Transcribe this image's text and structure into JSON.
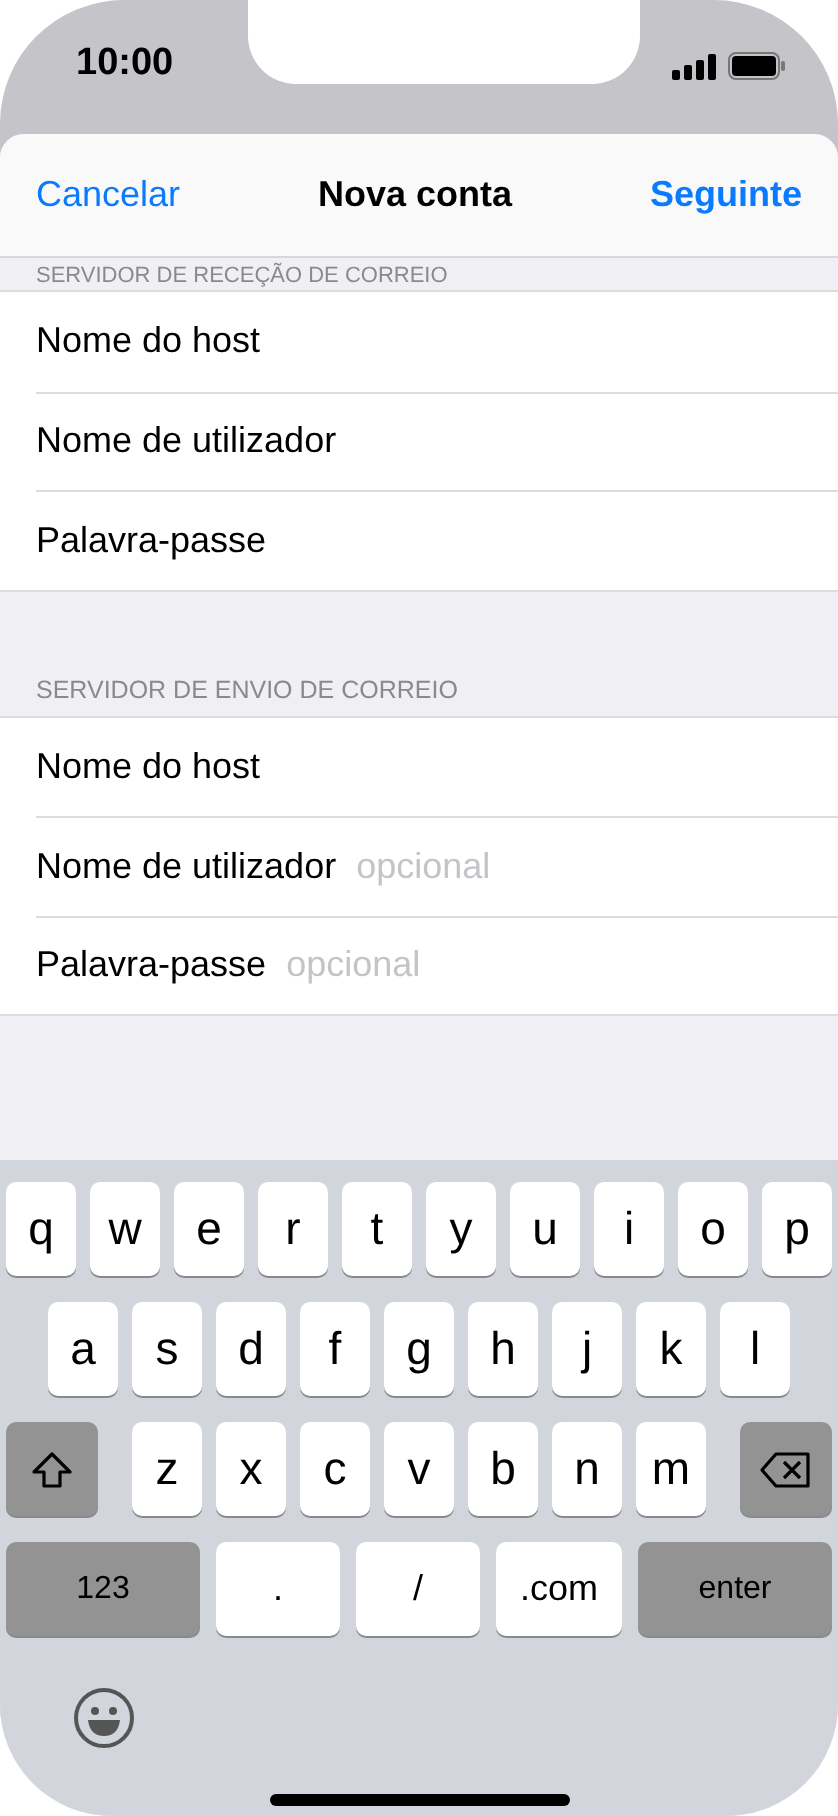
{
  "status_bar": {
    "time": "10:00"
  },
  "nav": {
    "left": "Cancelar",
    "title": "Nova conta",
    "right": "Seguinte"
  },
  "sections": [
    {
      "header": "SERVIDOR DE RECEÇÃO DE CORREIO",
      "header_clipped": true,
      "fields": [
        {
          "label": "Nome do host"
        },
        {
          "label": "Nome de utilizador"
        },
        {
          "label": "Palavra-passe"
        }
      ]
    },
    {
      "header": "SERVIDOR DE ENVIO DE CORREIO",
      "header_clipped": false,
      "fields": [
        {
          "label": "Nome do host"
        },
        {
          "label": "Nome de utilizador",
          "placeholder": "opcional"
        },
        {
          "label": "Palavra-passe",
          "placeholder": "opcional"
        }
      ]
    }
  ],
  "keyboard": {
    "rows": [
      {
        "keys": [
          {
            "kind": "letter",
            "label": "q"
          },
          {
            "kind": "letter",
            "label": "w"
          },
          {
            "kind": "letter",
            "label": "e"
          },
          {
            "kind": "letter",
            "label": "r"
          },
          {
            "kind": "letter",
            "label": "t"
          },
          {
            "kind": "letter",
            "label": "y"
          },
          {
            "kind": "letter",
            "label": "u"
          },
          {
            "kind": "letter",
            "label": "i"
          },
          {
            "kind": "letter",
            "label": "o"
          },
          {
            "kind": "letter",
            "label": "p"
          }
        ]
      },
      {
        "keys": [
          {
            "kind": "letter",
            "label": "a"
          },
          {
            "kind": "letter",
            "label": "s"
          },
          {
            "kind": "letter",
            "label": "d"
          },
          {
            "kind": "letter",
            "label": "f"
          },
          {
            "kind": "letter",
            "label": "g"
          },
          {
            "kind": "letter",
            "label": "h"
          },
          {
            "kind": "letter",
            "label": "j"
          },
          {
            "kind": "letter",
            "label": "k"
          },
          {
            "kind": "letter",
            "label": "l"
          }
        ]
      },
      {
        "keys": [
          {
            "kind": "shift"
          },
          {
            "kind": "letter",
            "label": "z"
          },
          {
            "kind": "letter",
            "label": "x"
          },
          {
            "kind": "letter",
            "label": "c"
          },
          {
            "kind": "letter",
            "label": "v"
          },
          {
            "kind": "letter",
            "label": "b"
          },
          {
            "kind": "letter",
            "label": "n"
          },
          {
            "kind": "letter",
            "label": "m"
          },
          {
            "kind": "backspace"
          }
        ]
      },
      {
        "keys": [
          {
            "kind": "function",
            "label": "123"
          },
          {
            "kind": "symbol",
            "label": "."
          },
          {
            "kind": "symbol",
            "label": "/"
          },
          {
            "kind": "symbol",
            "label": ".com"
          },
          {
            "kind": "function",
            "label": "enter"
          }
        ]
      }
    ]
  }
}
